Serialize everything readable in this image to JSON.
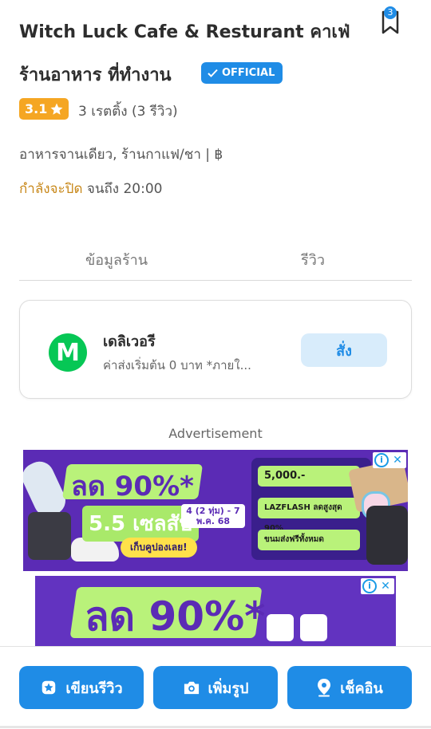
{
  "header": {
    "title_line1": "Witch Luck Cafe & Resturant คาเฟ่",
    "title_line2": "ร้านอาหาร ที่ทำงาน",
    "official_label": "OFFICIAL",
    "bookmark_count": "3"
  },
  "rating": {
    "score": "3.1",
    "summary": "3 เรตติ้ง (3 รีวิว)"
  },
  "category": "อาหารจานเดียว, ร้านกาแฟ/ชา | ฿",
  "hours": {
    "status": "กำลังจะปิด",
    "until": "จนถึง 20:00"
  },
  "tabs": [
    {
      "label": "ข้อมูลร้าน"
    },
    {
      "label": "รีวิว"
    }
  ],
  "delivery": {
    "logo_letter": "M",
    "title": "เดลิเวอรี",
    "subtitle": "ค่าส่งเริ่มต้น 0 บาท *ภายใ...",
    "order_label": "สั่ง"
  },
  "ads": {
    "label": "Advertisement",
    "banner1": {
      "headline": "ลด 90%*",
      "sub": "5.5 เซลสับ",
      "date": "4 (2 ทุ่ม) - 7 พ.ค. 68",
      "cta": "เก็บคูปองเลย!",
      "coupons": [
        "5,000.-",
        "LAZFLASH ลดสูงสุด 90%",
        "ขนมส่งฟรีทั้งหมด"
      ]
    },
    "banner2": {
      "headline": "ลด 90%*"
    }
  },
  "actions": [
    {
      "label": "เขียนรีวิว",
      "icon": "star-badge-icon"
    },
    {
      "label": "เพิ่มรูป",
      "icon": "camera-icon"
    },
    {
      "label": "เช็คอิน",
      "icon": "location-pin-icon"
    }
  ],
  "colors": {
    "primary": "#1f8ce6",
    "rating": "#f5a623",
    "closing": "#c8881a",
    "line_man": "#06c755"
  }
}
